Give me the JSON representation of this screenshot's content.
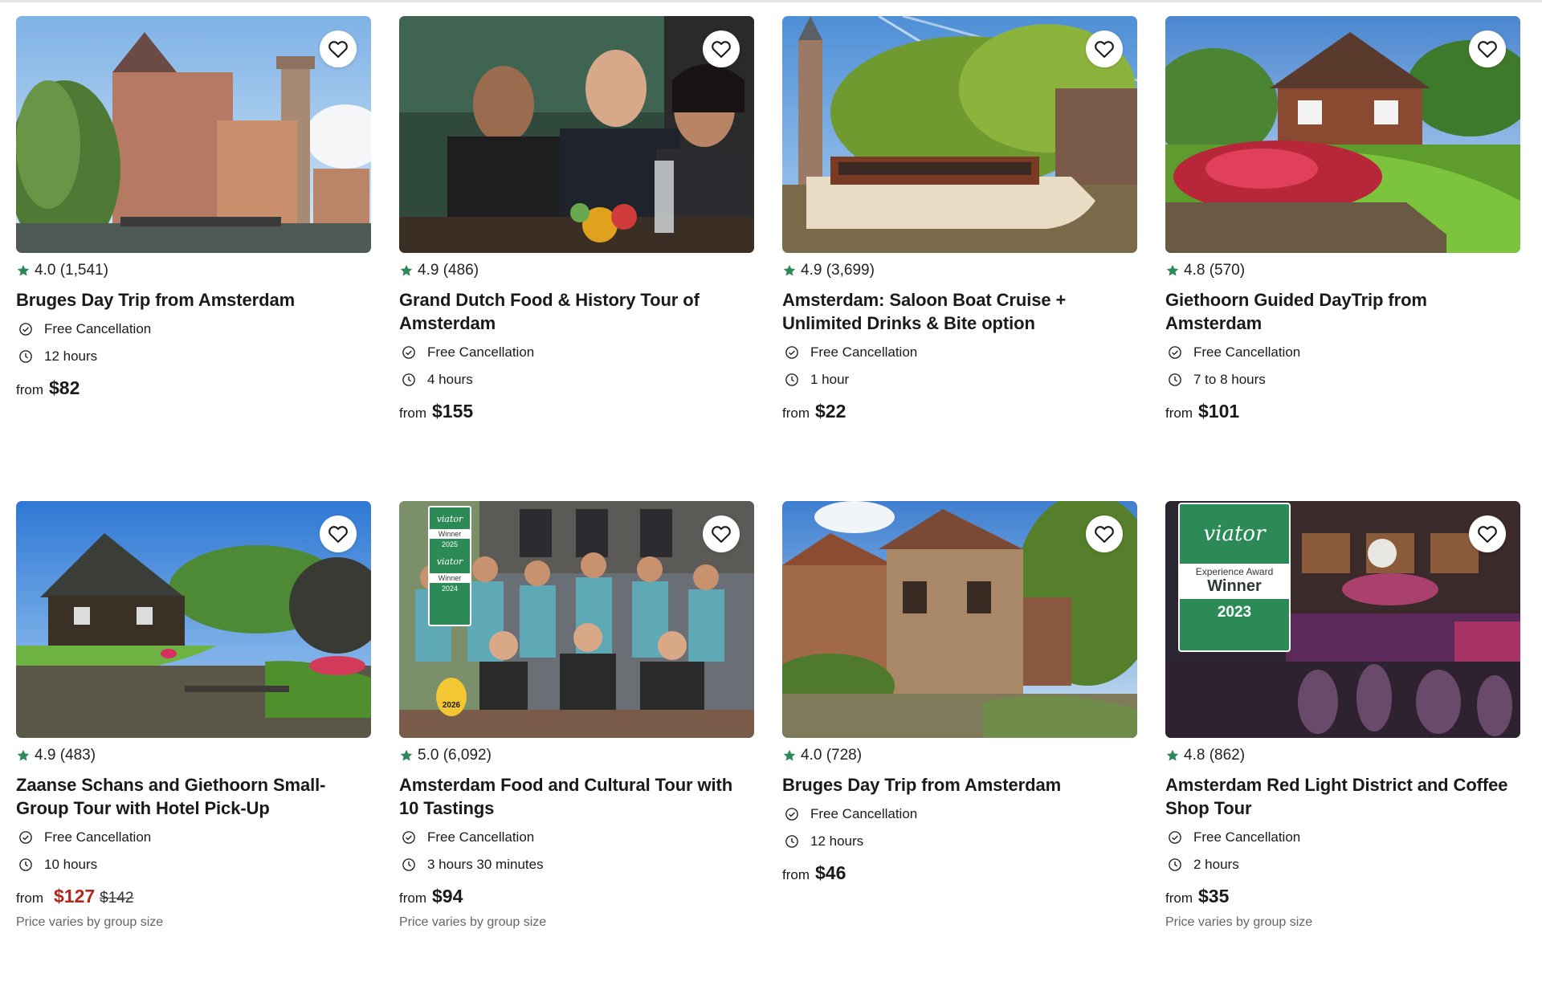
{
  "colors": {
    "star": "#2c8a57",
    "sale": "#b3261e",
    "award": "#2c8a57"
  },
  "cards": [
    {
      "rating": "4.0",
      "reviews": "(1,541)",
      "title": "Bruges Day Trip from Amsterdam",
      "features": [
        "Free Cancellation",
        "12 hours"
      ],
      "from_label": "from",
      "price": "$82",
      "sale_price": "",
      "original_price": "",
      "note": ""
    },
    {
      "rating": "4.9",
      "reviews": "(486)",
      "title": "Grand Dutch Food & History Tour of Amsterdam",
      "features": [
        "Free Cancellation",
        "4 hours"
      ],
      "from_label": "from",
      "price": "$155",
      "sale_price": "",
      "original_price": "",
      "note": ""
    },
    {
      "rating": "4.9",
      "reviews": "(3,699)",
      "title": "Amsterdam: Saloon Boat Cruise + Unlimited Drinks & Bite option",
      "features": [
        "Free Cancellation",
        "1 hour"
      ],
      "from_label": "from",
      "price": "$22",
      "sale_price": "",
      "original_price": "",
      "note": ""
    },
    {
      "rating": "4.8",
      "reviews": "(570)",
      "title": "Giethoorn Guided DayTrip from Amsterdam",
      "features": [
        "Free Cancellation",
        "7 to 8 hours"
      ],
      "from_label": "from",
      "price": "$101",
      "sale_price": "",
      "original_price": "",
      "note": ""
    },
    {
      "rating": "4.9",
      "reviews": "(483)",
      "title": "Zaanse Schans and Giethoorn Small-Group Tour with Hotel Pick-Up",
      "features": [
        "Free Cancellation",
        "10 hours"
      ],
      "from_label": "from",
      "price": "",
      "sale_price": "$127",
      "original_price": "$142",
      "note": "Price varies by group size"
    },
    {
      "rating": "5.0",
      "reviews": "(6,092)",
      "title": "Amsterdam Food and Cultural Tour with 10 Tastings",
      "features": [
        "Free Cancellation",
        "3 hours 30 minutes"
      ],
      "from_label": "from",
      "price": "$94",
      "sale_price": "",
      "original_price": "",
      "note": "Price varies by group size",
      "badge": {
        "brand": "viator",
        "label": "Winner",
        "years": [
          "2025",
          "2024"
        ],
        "sticker_year": "2026"
      }
    },
    {
      "rating": "4.0",
      "reviews": "(728)",
      "title": "Bruges Day Trip from Amsterdam",
      "features": [
        "Free Cancellation",
        "12 hours"
      ],
      "from_label": "from",
      "price": "$46",
      "sale_price": "",
      "original_price": "",
      "note": ""
    },
    {
      "rating": "4.8",
      "reviews": "(862)",
      "title": "Amsterdam Red Light District and Coffee Shop Tour",
      "features": [
        "Free Cancellation",
        "2 hours"
      ],
      "from_label": "from",
      "price": "$35",
      "sale_price": "",
      "original_price": "",
      "note": "Price varies by group size",
      "badge": {
        "brand": "viator",
        "award": "Experience Award",
        "label": "Winner",
        "year": "2023"
      }
    }
  ]
}
